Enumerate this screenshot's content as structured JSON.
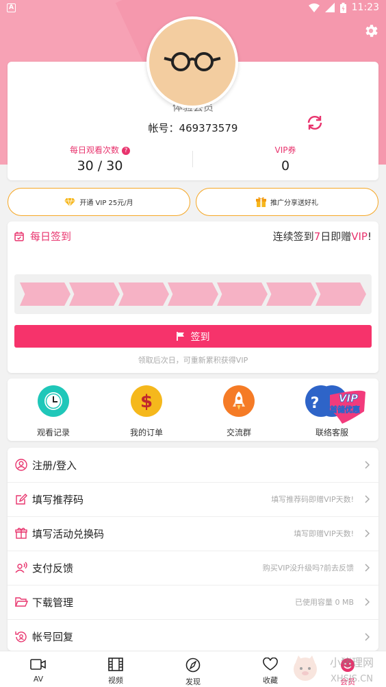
{
  "status_bar": {
    "time": "11:23",
    "badge": "A"
  },
  "profile": {
    "member_name": "体验会员",
    "account_label": "帐号：",
    "account_id": "469373579",
    "stats": [
      {
        "label": "每日观看次数",
        "value": "30 / 30",
        "help": "?"
      },
      {
        "label": "VIP券",
        "value": "0"
      }
    ]
  },
  "promos": {
    "vip": "开通 VIP 25元/月",
    "share": "推广分享送好礼"
  },
  "checkin": {
    "title": "每日签到",
    "note_prefix": "连续签到",
    "note_days": "7",
    "note_mid": "日即赠",
    "note_vip": "VIP",
    "note_suffix": "!",
    "button": "签到",
    "hint": "领取后次日，可重新累积获得VIP",
    "steps": 7
  },
  "quick_links": [
    {
      "label": "观看记录",
      "icon": "clock-icon",
      "color": "#1fc7b9"
    },
    {
      "label": "我的订单",
      "icon": "dollar-icon",
      "color": "#f5b81c"
    },
    {
      "label": "交流群",
      "icon": "rocket-icon",
      "color": "#f57b26"
    },
    {
      "label": "联络客服",
      "icon": "help-icon",
      "color": "#2e64c8",
      "badge_top": "VIP",
      "badge_bottom": "首储优惠"
    }
  ],
  "menu": [
    {
      "label": "注册/登入",
      "hint": "",
      "icon": "user-icon"
    },
    {
      "label": "填写推荐码",
      "hint": "填写推荐码即赠VIP天数!",
      "icon": "edit-icon"
    },
    {
      "label": "填写活动兑换码",
      "hint": "填写即赠VIP天数!",
      "icon": "gift-icon"
    },
    {
      "label": "支付反馈",
      "hint": "购买VIP没升级吗?前去反馈",
      "icon": "feedback-icon"
    },
    {
      "label": "下载管理",
      "hint": "已使用容量 0 MB",
      "icon": "folder-icon"
    },
    {
      "label": "帐号回复",
      "hint": "",
      "icon": "account-restore-icon"
    }
  ],
  "tabs": [
    {
      "label": "AV",
      "icon": "video-icon",
      "active": false
    },
    {
      "label": "视频",
      "icon": "film-icon",
      "active": false
    },
    {
      "label": "发现",
      "icon": "compass-icon",
      "active": false
    },
    {
      "label": "收藏",
      "icon": "heart-icon",
      "active": false
    },
    {
      "label": "会员",
      "icon": "member-icon",
      "active": true
    }
  ],
  "watermark": {
    "text_top": "小猪理网",
    "text_bottom": "XHSJS.CN"
  },
  "colors": {
    "accent": "#e8336d",
    "header": "#f7a2b5",
    "button": "#f6336b",
    "promo_border": "#f5a623"
  }
}
